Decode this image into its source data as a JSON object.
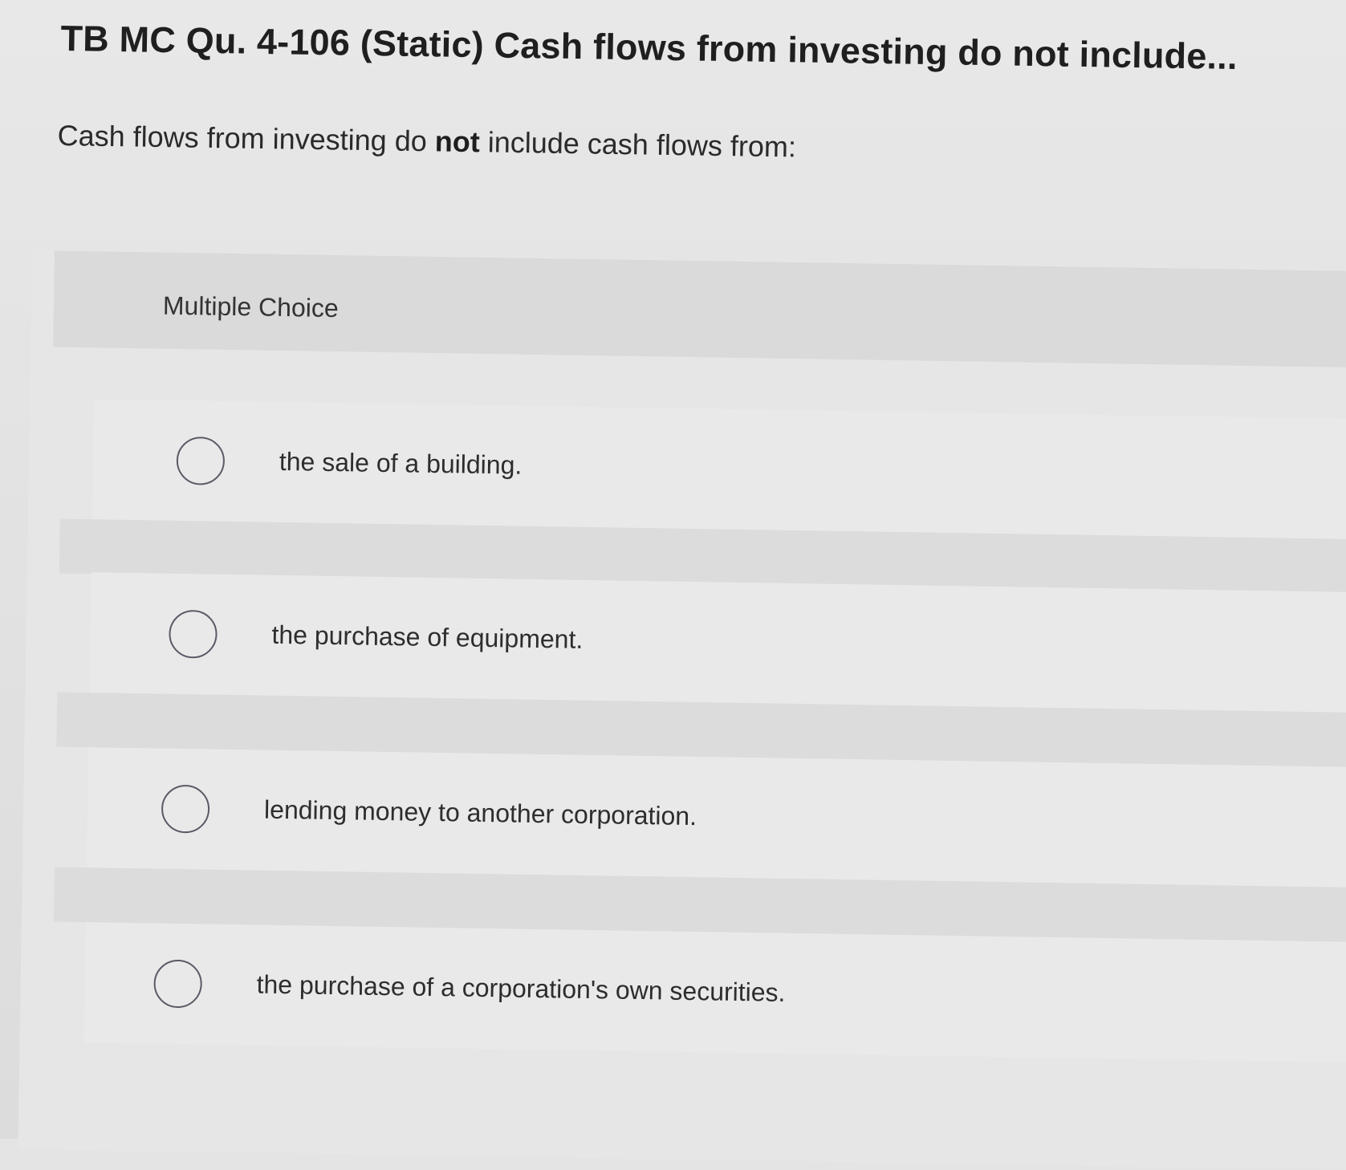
{
  "question": {
    "title": "TB MC Qu. 4-106 (Static) Cash flows from investing do not include...",
    "prompt_before": "Cash flows from investing do ",
    "prompt_bold": "not",
    "prompt_after": " include cash flows from:"
  },
  "multiple_choice": {
    "header": "Multiple Choice",
    "choices": [
      {
        "label": "the sale of a building."
      },
      {
        "label": "the purchase of equipment."
      },
      {
        "label": "lending money to another corporation."
      },
      {
        "label": "the purchase of a corporation's own securities."
      }
    ]
  }
}
